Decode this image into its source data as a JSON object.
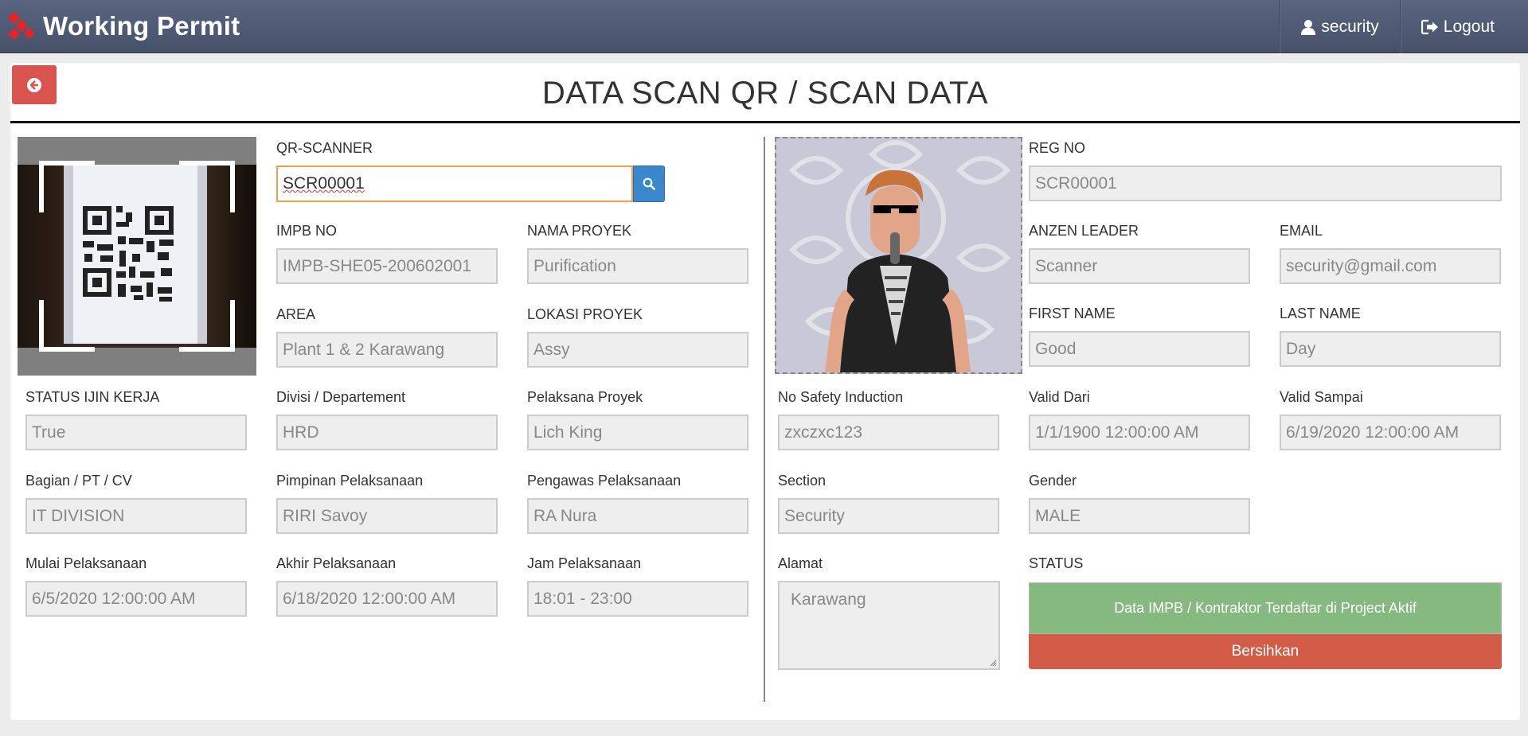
{
  "header": {
    "brand": "Working Permit",
    "user_label": "security",
    "logout_label": "Logout",
    "user_icon": "user-icon",
    "logout_icon": "logout-icon"
  },
  "page": {
    "title": "DATA SCAN QR / SCAN DATA",
    "back_icon": "circle-arrow-left-icon"
  },
  "left": {
    "qr_scanner_label": "QR-SCANNER",
    "qr_scanner_value": "SCR00001",
    "search_icon": "search-icon",
    "impb_no_label": "IMPB NO",
    "impb_no_value": "IMPB-SHE05-200602001",
    "nama_proyek_label": "NAMA PROYEK",
    "nama_proyek_value": "Purification",
    "area_label": "AREA",
    "area_value": "Plant 1 & 2 Karawang",
    "lokasi_proyek_label": "LOKASI PROYEK",
    "lokasi_proyek_value": "Assy",
    "status_ijin_label": "STATUS IJIN KERJA",
    "status_ijin_value": "True",
    "divisi_label": "Divisi / Departement",
    "divisi_value": "HRD",
    "pelaksana_label": "Pelaksana Proyek",
    "pelaksana_value": "Lich King",
    "bagian_label": "Bagian / PT / CV",
    "bagian_value": "IT DIVISION",
    "pimpinan_label": "Pimpinan Pelaksanaan",
    "pimpinan_value": "RIRI Savoy",
    "pengawas_label": "Pengawas Pelaksanaan",
    "pengawas_value": "RA Nura",
    "mulai_label": "Mulai Pelaksanaan",
    "mulai_value": "6/5/2020 12:00:00 AM",
    "akhir_label": "Akhir Pelaksanaan",
    "akhir_value": "6/18/2020 12:00:00 AM",
    "jam_label": "Jam Pelaksanaan",
    "jam_value": "18:01 - 23:00"
  },
  "right": {
    "reg_no_label": "REG NO",
    "reg_no_value": "SCR00001",
    "anzen_label": "ANZEN LEADER",
    "anzen_value": "Scanner",
    "email_label": "EMAIL",
    "email_value": "security@gmail.com",
    "first_name_label": "FIRST NAME",
    "first_name_value": "Good",
    "last_name_label": "LAST NAME",
    "last_name_value": "Day",
    "no_safety_label": "No Safety Induction",
    "no_safety_value": "zxczxc123",
    "valid_dari_label": "Valid Dari",
    "valid_dari_value": "1/1/1900 12:00:00 AM",
    "valid_sampai_label": "Valid Sampai",
    "valid_sampai_value": "6/19/2020 12:00:00 AM",
    "section_label": "Section",
    "section_value": "Security",
    "gender_label": "Gender",
    "gender_value": "MALE",
    "alamat_label": "Alamat",
    "alamat_value": "Karawang",
    "status_label": "STATUS",
    "status_message": "Data IMPB / Kontraktor Terdaftar di Project Aktif",
    "clear_button": "Bersihkan"
  },
  "colors": {
    "navbar": "#4f5a73",
    "back_button": "#d9534f",
    "search_button": "#3a87cc",
    "status_ok": "#86b97f",
    "clear_button": "#d35c48",
    "focus_border": "#f0a04a"
  }
}
